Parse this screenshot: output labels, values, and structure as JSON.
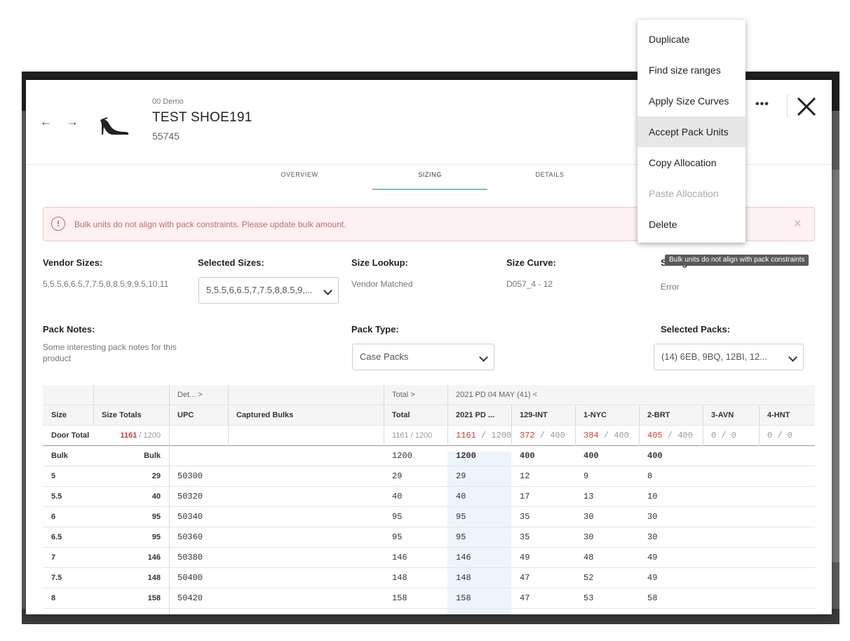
{
  "product": {
    "brand": "00 Demo",
    "title": "TEST SHOE191",
    "number": "55745"
  },
  "header": {
    "nav_label": "← →",
    "more_label": "•••"
  },
  "tabs": [
    {
      "label": "OVERVIEW"
    },
    {
      "label": "SIZING"
    },
    {
      "label": "DETAILS"
    }
  ],
  "alert": {
    "text": "Bulk units do not align with pack constraints. Please update bulk amount.",
    "icon": "!",
    "close": "×"
  },
  "fields": {
    "vendor_sizes": {
      "label": "Vendor Sizes:",
      "value": "5,5.5,6,6.5,7,7.5,8,8.5,9,9.5,10,11"
    },
    "selected_sizes": {
      "label": "Selected Sizes:",
      "value": "5,5.5,6,6.5,7,7.5,8,8.5,9,..."
    },
    "size_lookup": {
      "label": "Size Lookup:",
      "value": "Vendor Matched"
    },
    "size_curve": {
      "label": "Size Curve:",
      "value": "D057_4 - 12"
    },
    "sizing_status": {
      "label": "Sizing Status:",
      "value": "Error",
      "icon": "!"
    },
    "pack_notes": {
      "label": "Pack Notes:",
      "value": "Some interesting pack notes for this product"
    },
    "pack_type": {
      "label": "Pack Type:",
      "value": "Case Packs"
    },
    "selected_packs": {
      "label": "Selected Packs:",
      "value": "(14) 6EB, 9BQ, 12BI, 12..."
    }
  },
  "table": {
    "group_headers": {
      "details": "Det...  >",
      "total": "Total  >",
      "period": "2021 PD 04 MAY (41)  <"
    },
    "columns": [
      "Size",
      "Size Totals",
      "UPC",
      "Captured Bulks",
      "Total",
      "2021 PD ...",
      "129-INT",
      "1-NYC",
      "2-BRT",
      "3-AVN",
      "4-HNT"
    ],
    "door_total": {
      "label": "Door Total",
      "size_totals": {
        "num": "1161",
        "den": " / 1200"
      },
      "total": "1161 / 1200",
      "period": {
        "num": "1161",
        "den": " / 1200"
      },
      "int": {
        "num": "372",
        "den": " / 400"
      },
      "nyc": {
        "num": "384",
        "den": " / 400"
      },
      "brt": {
        "num": "405",
        "den": " / 400"
      },
      "avn": "0 / 0",
      "hnt": "0 / 0"
    },
    "bulk": {
      "label": "Bulk",
      "size_totals": "Bulk",
      "total": "1200",
      "period": "1200",
      "int": "400",
      "nyc": "400",
      "brt": "400"
    },
    "rows": [
      {
        "size": "5",
        "totals": "29",
        "upc": "50300",
        "total": "29",
        "period": "29",
        "int": "12",
        "nyc": "9",
        "brt": "8"
      },
      {
        "size": "5.5",
        "totals": "40",
        "upc": "50320",
        "total": "40",
        "period": "40",
        "int": "17",
        "nyc": "13",
        "brt": "10"
      },
      {
        "size": "6",
        "totals": "95",
        "upc": "50340",
        "total": "95",
        "period": "95",
        "int": "35",
        "nyc": "30",
        "brt": "30"
      },
      {
        "size": "6.5",
        "totals": "95",
        "upc": "50360",
        "total": "95",
        "period": "95",
        "int": "35",
        "nyc": "30",
        "brt": "30"
      },
      {
        "size": "7",
        "totals": "146",
        "upc": "50380",
        "total": "146",
        "period": "146",
        "int": "49",
        "nyc": "48",
        "brt": "49"
      },
      {
        "size": "7.5",
        "totals": "148",
        "upc": "50400",
        "total": "148",
        "period": "148",
        "int": "47",
        "nyc": "52",
        "brt": "49"
      },
      {
        "size": "8",
        "totals": "158",
        "upc": "50420",
        "total": "158",
        "period": "158",
        "int": "47",
        "nyc": "53",
        "brt": "58"
      }
    ]
  },
  "menu": {
    "items": [
      {
        "label": "Duplicate"
      },
      {
        "label": "Find size ranges"
      },
      {
        "label": "Apply Size Curves"
      },
      {
        "label": "Accept Pack Units"
      },
      {
        "label": "Copy Allocation"
      },
      {
        "label": "Paste Allocation"
      },
      {
        "label": "Delete"
      }
    ]
  },
  "tooltip": "Bulk units do not align with pack constraints",
  "colors": {
    "error": "#d0473a",
    "tab_accent": "#7fbdbd",
    "alert_bg": "#fdf1f1",
    "highlight_col": "#eef4fb"
  }
}
